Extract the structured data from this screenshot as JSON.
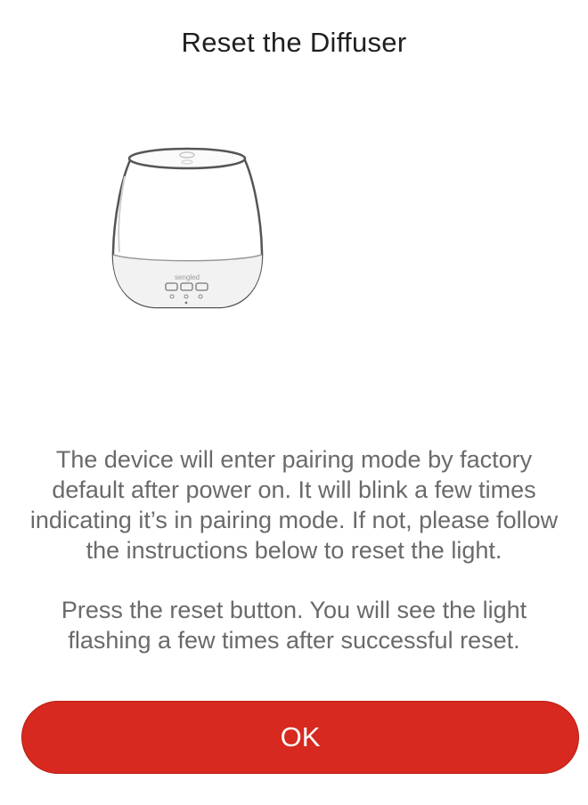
{
  "header": {
    "title": "Reset the Diffuser"
  },
  "illustration": {
    "brand_text": "sengled",
    "accent_color": "#d7291f"
  },
  "content": {
    "paragraph_1": "The device will enter pairing mode by factory default after power on. It will blink a few times indicating it’s in pairing mode. If not, please follow the instructions below to reset the light.",
    "paragraph_2": "Press the reset button. You will see the light flashing a few times after successful reset."
  },
  "footer": {
    "ok_label": "OK"
  }
}
